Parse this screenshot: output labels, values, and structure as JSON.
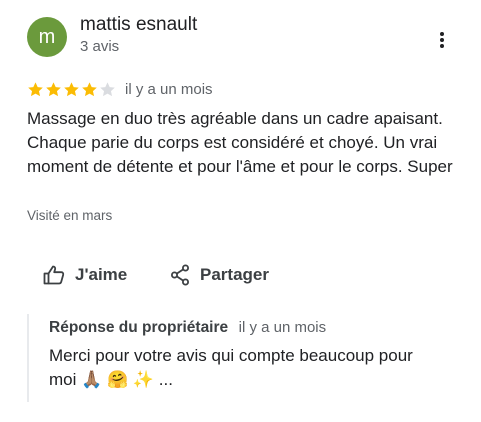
{
  "author": {
    "initial": "m",
    "name": "mattis esnault",
    "review_count": "3 avis",
    "avatar_color": "#6b9a3c"
  },
  "rating": {
    "value": 4,
    "max": 5,
    "filled_color": "#fbbc04",
    "empty_color": "#dadce0"
  },
  "review": {
    "date": "il y a un mois",
    "text": "Massage en duo très agréable dans un cadre apaisant. Chaque parie du corps est considéré et choyé. Un vrai moment de détente et pour l'âme et pour le corps. Super",
    "visit": "Visité en mars"
  },
  "actions": {
    "like_label": "J'aime",
    "like_icon": "thumb-up-icon",
    "share_label": "Partager",
    "share_icon": "share-icon",
    "more_icon": "more-vert-icon"
  },
  "owner_reply": {
    "label": "Réponse du propriétaire",
    "date": "il y a un mois",
    "text": "Merci pour votre avis qui compte beaucoup pour moi 🙏🏽 🤗 ✨ ..."
  },
  "colors": {
    "primary_text": "#202124",
    "secondary_text": "#5f6368",
    "action_text": "#3c4043",
    "divider": "#e8eaed"
  }
}
